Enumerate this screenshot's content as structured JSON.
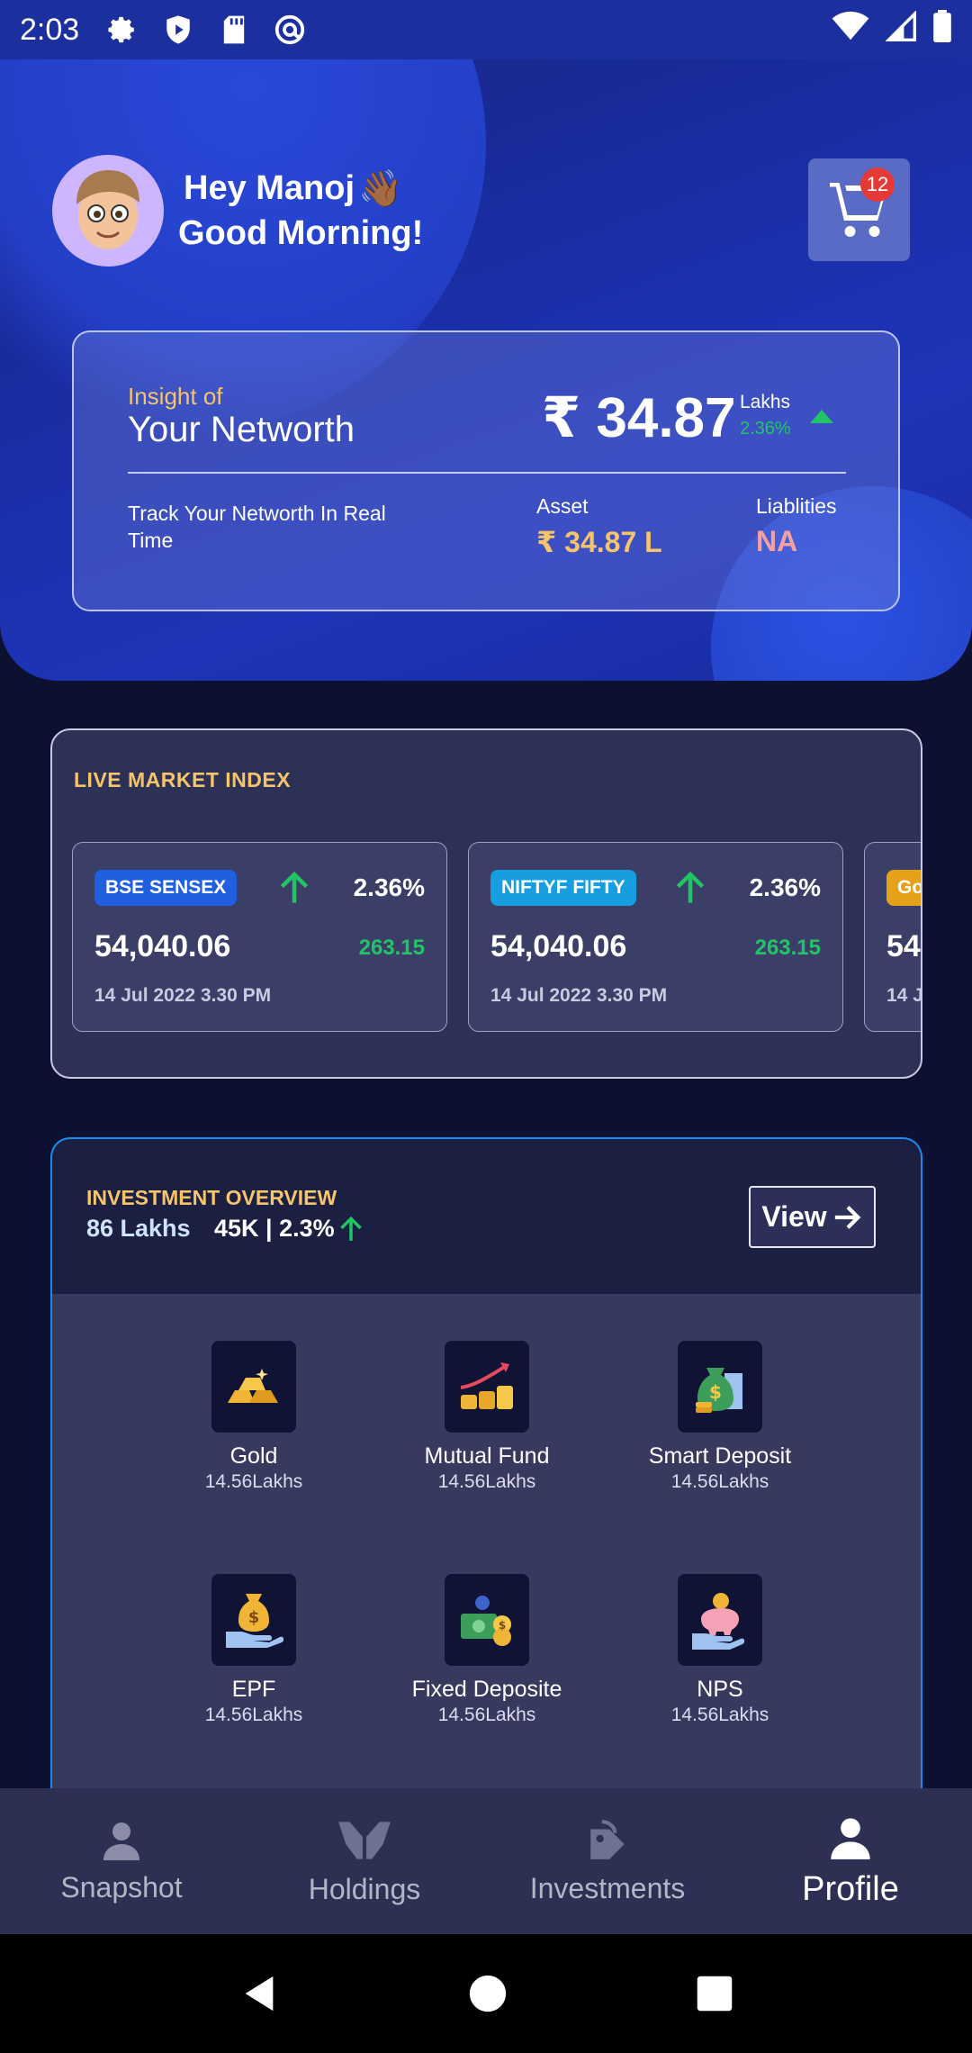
{
  "status_bar": {
    "time": "2:03"
  },
  "header": {
    "greeting_line1": "Hey Manoj",
    "greeting_line2": "Good Morning!",
    "wave_emoji": "👋🏾",
    "cart_count": "12"
  },
  "networth": {
    "insight_label": "Insight of",
    "title": "Your Networth",
    "value": "₹ 34.87",
    "unit": "Lakhs",
    "change_pct": "2.36%",
    "track_text": "Track Your Networth In Real Time",
    "asset_label": "Asset",
    "asset_value": "₹ 34.87 L",
    "liabilities_label": "Liablities",
    "liabilities_value": "NA"
  },
  "market": {
    "title": "LIVE MARKET INDEX",
    "cards": [
      {
        "name": "BSE SENSEX",
        "pct": "2.36%",
        "value": "54,040.06",
        "change": "263.15",
        "date": "14 Jul 2022 3.30 PM",
        "tag_color": "#1f5fe0"
      },
      {
        "name": "NIFTYF FIFTY",
        "pct": "2.36%",
        "value": "54,040.06",
        "change": "263.15",
        "date": "14 Jul 2022 3.30 PM",
        "tag_color": "#169ee0"
      },
      {
        "name": "Go",
        "pct": "",
        "value": "54",
        "change": "",
        "date": "14 J",
        "tag_color": "#e3a21a"
      }
    ]
  },
  "investment": {
    "title": "INVESTMENT OVERVIEW",
    "total": "86 Lakhs",
    "change": "45K | 2.3%",
    "view_label": "View",
    "items": [
      {
        "label": "Gold",
        "amount": "14.56Lakhs",
        "icon": "gold-bars-icon"
      },
      {
        "label": "Mutual Fund",
        "amount": "14.56Lakhs",
        "icon": "mutual-fund-growth-icon"
      },
      {
        "label": "Smart Deposit",
        "amount": "14.56Lakhs",
        "icon": "money-bag-coins-icon"
      },
      {
        "label": "EPF",
        "amount": "14.56Lakhs",
        "icon": "hand-money-bag-icon"
      },
      {
        "label": "Fixed Deposite",
        "amount": "14.56Lakhs",
        "icon": "cash-coins-icon"
      },
      {
        "label": "NPS",
        "amount": "14.56Lakhs",
        "icon": "piggy-bank-icon"
      }
    ]
  },
  "bottom_nav": [
    {
      "label": "Snapshot",
      "icon": "person-icon"
    },
    {
      "label": "Holdings",
      "icon": "hands-icon"
    },
    {
      "label": "Investments",
      "icon": "investment-tag-icon"
    },
    {
      "label": "Profile",
      "icon": "person-icon",
      "active": true
    }
  ],
  "colors": {
    "accent_gold": "#f6c46a",
    "positive": "#23c466",
    "liability": "#f4a0a0",
    "highlight_border": "#1a8bf0"
  }
}
